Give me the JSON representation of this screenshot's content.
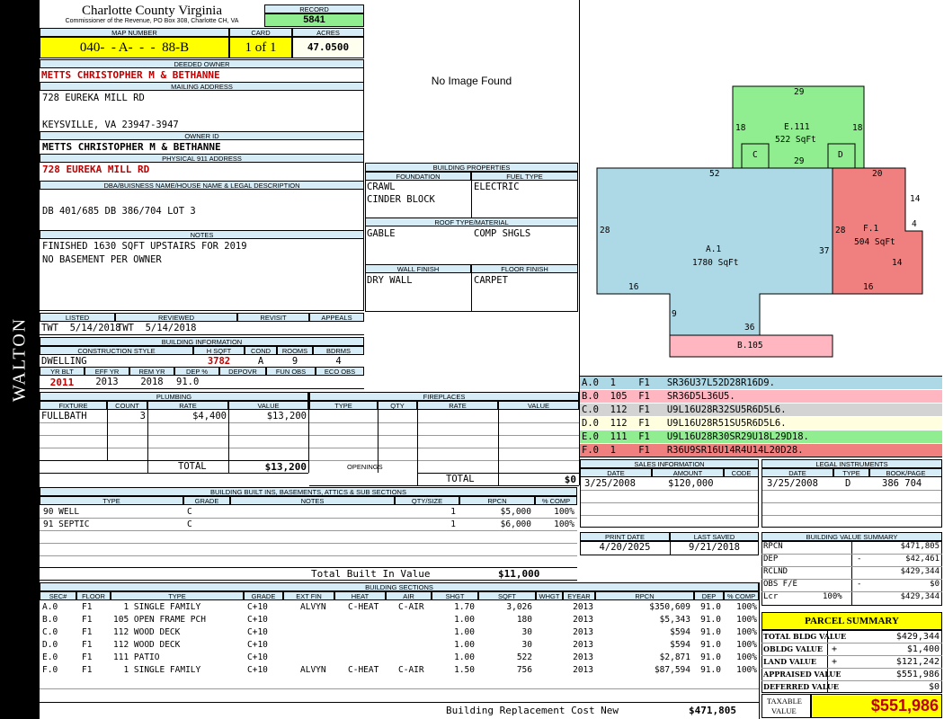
{
  "side_label": "WALTON",
  "header": {
    "county": "Charlotte County Virginia",
    "commissioner": "Commissioner of the Revenue, PO Box 308, Charlotte CH, VA",
    "record_label": "RECORD",
    "record": "5841",
    "map_label": "MAP NUMBER",
    "map_number": "040-  - A-  -  -  88-B",
    "card_label": "CARD",
    "card": "1 of 1",
    "acres_label": "ACRES",
    "acres": "47.0500"
  },
  "owner": {
    "deeded_label": "DEEDED OWNER",
    "deeded": "METTS CHRISTOPHER M & BETHANNE",
    "mailing_label": "MAILING ADDRESS",
    "mail1": "728 EUREKA MILL RD",
    "mail2": "KEYSVILLE, VA 23947-3947",
    "owner_id_label": "OWNER ID",
    "owner_id": "METTS CHRISTOPHER M & BETHANNE",
    "physical_label": "PHYSICAL 911 ADDRESS",
    "physical": "728 EUREKA MILL RD",
    "dba_label": "DBA/BUISNESS NAME/HOUSE NAME & LEGAL DESCRIPTION",
    "dba": "DB 401/685 DB 386/704 LOT 3",
    "notes_label": "NOTES",
    "note1": "FINISHED 1630 SQFT UPSTAIRS FOR 2019",
    "note2": "NO BASEMENT PER OWNER"
  },
  "listing": {
    "listed_label": "LISTED",
    "reviewed_label": "REVIEWED",
    "revisit_label": "REVISIT",
    "appeals_label": "APPEALS",
    "listed": "TWT  5/14/2018",
    "reviewed": "TWT  5/14/2018"
  },
  "building_info": {
    "title": "BUILDING INFORMATION",
    "h_style": "CONSTRUCTION STYLE",
    "h_hsqft": "H SQFT",
    "h_cond": "COND",
    "h_rooms": "ROOMS",
    "h_bdrms": "BDRMS",
    "style": "DWELLING",
    "hsqft": "3782",
    "cond": "A",
    "rooms": "9",
    "bdrms": "4",
    "h_yrblt": "YR BLT",
    "h_effyr": "EFF YR",
    "h_remyr": "REM YR",
    "h_dep": "DEP %",
    "h_depovr": "DEPOVR",
    "h_funobs": "FUN OBS",
    "h_ecoobs": "ECO OBS",
    "yrblt": "2011",
    "effyr": "2013",
    "remyr": "2018",
    "dep": "91.0"
  },
  "image": {
    "no_image": "No Image Found"
  },
  "building_properties": {
    "title": "BUILDING PROPERTIES",
    "foundation_label": "FOUNDATION",
    "fuel_label": "FUEL TYPE",
    "foundation1": "CRAWL",
    "foundation2": "CINDER BLOCK",
    "fuel": "ELECTRIC",
    "roof_label": "ROOF TYPE/MATERIAL",
    "roof_type": "GABLE",
    "roof_material": "COMP SHGLS",
    "wall_label": "WALL FINISH",
    "floor_label": "FLOOR FINISH",
    "wall": "DRY WALL",
    "floor": "CARPET"
  },
  "sketch": {
    "e_label": "E.111",
    "e_area": "522 SqFt",
    "e_top": "29",
    "e_left": "18",
    "e_right": "18",
    "e_inner": "29",
    "c_label": "C",
    "d_label": "D",
    "a_label": "A.1",
    "a_area": "1780 SqFt",
    "a_top": "52",
    "a_left": "28",
    "a_right": "37",
    "a_bl": "16",
    "a_step": "9",
    "a_bottom": "36",
    "f_label": "F.1",
    "f_area": "504 SqFt",
    "f_top": "20",
    "f_left": "28",
    "f_r1": "14",
    "f_r2": "4",
    "f_r3": "14",
    "f_bottom": "16",
    "b_label": "B.105"
  },
  "sketch_codes": [
    {
      "code": "A.0  1    F1   SR36U37L52D28R16D9.",
      "color": "#add8e6"
    },
    {
      "code": "B.0  105  F1   SR36D5L36U5.",
      "color": "#ffb6c1"
    },
    {
      "code": "C.0  112  F1   U9L16U28R32SU5R6D5L6.",
      "color": "#d3d3d3"
    },
    {
      "code": "D.0  112  F1   U9L16U28R51SU5R6D5L6.",
      "color": "#ffffe0"
    },
    {
      "code": "E.0  111  F1   U9L16U28R30SR29U18L29D18.",
      "color": "#90ee90"
    },
    {
      "code": "F.0  1    F1   R36U9SR16U14R4U14L20D28.",
      "color": "#f08080"
    }
  ],
  "sales": {
    "title": "SALES INFORMATION",
    "date_h": "DATE",
    "amount_h": "AMOUNT",
    "code_h": "CODE",
    "date": "3/25/2008",
    "amount": "$120,000"
  },
  "legal": {
    "title": "LEGAL INSTRUMENTS",
    "date_h": "DATE",
    "type_h": "TYPE",
    "book_h": "BOOK/PAGE",
    "date": "3/25/2008",
    "type": "D",
    "book": "386 704"
  },
  "print": {
    "print_h": "PRINT DATE",
    "saved_h": "LAST SAVED",
    "print_date": "4/20/2025",
    "saved": "9/21/2018"
  },
  "value_summary": {
    "title": "BUILDING VALUE SUMMARY",
    "rpcn_l": "RPCN",
    "rpcn": "$471,805",
    "dep_l": "DEP",
    "dep_s": "-",
    "dep": "$42,461",
    "rclnd_l": "RCLND",
    "rclnd": "$429,344",
    "obs_l": "OBS F/E",
    "obs_s": "-",
    "obs": "$0",
    "lcr_l": "Lcr",
    "lcr_pct": "100%",
    "lcr": "$429,344"
  },
  "parcel": {
    "title": "PARCEL SUMMARY",
    "tbv_l": "TOTAL BLDG VALUE",
    "tbv": "$429,344",
    "ob_l": "OBLDG VALUE",
    "ob_s": "+",
    "ob": "$1,400",
    "land_l": "LAND VALUE",
    "land_s": "+",
    "land": "$121,242",
    "appr_l": "APPRAISED VALUE",
    "appr": "$551,986",
    "def_l": "DEFERRED VALUE",
    "def_s": "-",
    "def": "$0",
    "tax_l1": "TAXABLE",
    "tax_l2": "VALUE",
    "tax": "$551,986"
  },
  "plumbing": {
    "title": "PLUMBING",
    "fixture_h": "FIXTURE",
    "count_h": "COUNT",
    "rate_h": "RATE",
    "value_h": "VALUE",
    "fixture": "FULLBATH",
    "count": "3",
    "rate": "$4,400",
    "value": "$13,200",
    "total_l": "TOTAL",
    "total": "$13,200"
  },
  "fireplaces": {
    "title": "FIREPLACES",
    "type_h": "TYPE",
    "qty_h": "QTY",
    "rate_h": "RATE",
    "value_h": "VALUE",
    "openings": "OPENINGS",
    "total_l": "TOTAL",
    "total": "$0"
  },
  "builtins": {
    "title": "BUILDING BUILT INS, BASEMENTS, ATTICS & SUB SECTIONS",
    "type_h": "TYPE",
    "grade_h": "GRADE",
    "notes_h": "NOTES",
    "qty_h": "QTY/SIZE",
    "rpcn_h": "RPCN",
    "comp_h": "% COMP",
    "rows": [
      {
        "type": "90 WELL",
        "grade": "C",
        "qty": "1",
        "rpcn": "$5,000",
        "comp": "100%"
      },
      {
        "type": "91 SEPTIC",
        "grade": "C",
        "qty": "1",
        "rpcn": "$6,000",
        "comp": "100%"
      }
    ],
    "total_l": "Total Built In Value",
    "total": "$11,000"
  },
  "sections": {
    "title": "BUILDING SECTIONS",
    "h": {
      "sec": "SEC#",
      "floor": "FLOOR",
      "type": "TYPE",
      "grade": "GRADE",
      "extfin": "EXT FIN",
      "heat": "HEAT",
      "air": "AIR",
      "shgt": "SHGT",
      "sqft": "SQFT",
      "whgt": "WHGT",
      "eyear": "EYEAR",
      "rpcn": "RPCN",
      "dep": "DEP",
      "comp": "% COMP"
    },
    "rows": [
      {
        "sec": "A.0",
        "floor": "F1",
        "type": "  1 SINGLE FAMILY",
        "grade": "C+10",
        "extfin": "ALVYN",
        "heat": "C-HEAT",
        "air": "C-AIR",
        "shgt": "1.70",
        "sqft": "3,026",
        "eyear": "2013",
        "rpcn": "$350,609",
        "dep": "91.0",
        "comp": "100%"
      },
      {
        "sec": "B.0",
        "floor": "F1",
        "type": "105 OPEN FRAME PCH",
        "grade": "C+10",
        "extfin": "",
        "heat": "",
        "air": "",
        "shgt": "1.00",
        "sqft": "180",
        "eyear": "2013",
        "rpcn": "$5,343",
        "dep": "91.0",
        "comp": "100%"
      },
      {
        "sec": "C.0",
        "floor": "F1",
        "type": "112 WOOD DECK",
        "grade": "C+10",
        "extfin": "",
        "heat": "",
        "air": "",
        "shgt": "1.00",
        "sqft": "30",
        "eyear": "2013",
        "rpcn": "$594",
        "dep": "91.0",
        "comp": "100%"
      },
      {
        "sec": "D.0",
        "floor": "F1",
        "type": "112 WOOD DECK",
        "grade": "C+10",
        "extfin": "",
        "heat": "",
        "air": "",
        "shgt": "1.00",
        "sqft": "30",
        "eyear": "2013",
        "rpcn": "$594",
        "dep": "91.0",
        "comp": "100%"
      },
      {
        "sec": "E.0",
        "floor": "F1",
        "type": "111 PATIO",
        "grade": "C+10",
        "extfin": "",
        "heat": "",
        "air": "",
        "shgt": "1.00",
        "sqft": "522",
        "eyear": "2013",
        "rpcn": "$2,871",
        "dep": "91.0",
        "comp": "100%"
      },
      {
        "sec": "F.0",
        "floor": "F1",
        "type": "  1 SINGLE FAMILY",
        "grade": "C+10",
        "extfin": "ALVYN",
        "heat": "C-HEAT",
        "air": "C-AIR",
        "shgt": "1.50",
        "sqft": "756",
        "eyear": "2013",
        "rpcn": "$87,594",
        "dep": "91.0",
        "comp": "100%"
      }
    ],
    "total_l": "Building Replacement Cost New",
    "total": "$471,805"
  }
}
